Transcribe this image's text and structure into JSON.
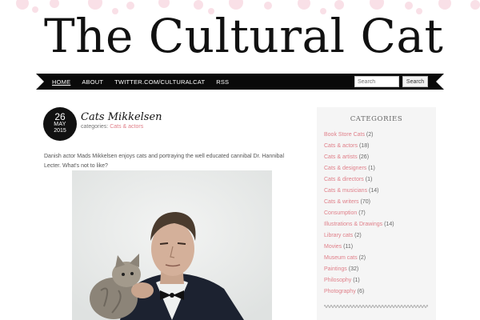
{
  "site": {
    "title": "The Cultural Cat"
  },
  "nav": {
    "items": [
      "HOME",
      "ABOUT",
      "TWITTER.COM/CULTURALCAT",
      "RSS"
    ],
    "search_placeholder": "Search",
    "search_button": "Search"
  },
  "post": {
    "date": {
      "day": "26",
      "month": "MAY",
      "year": "2015"
    },
    "title": "Cats Mikkelsen",
    "categories_label": "categories:",
    "category": "Cats & actors",
    "body": "Danish actor Mads Mikkelsen enjoys cats and portraying the well educated cannibal Dr. Hannibal Lecter. What's not to like?"
  },
  "sidebar": {
    "title": "CATEGORIES",
    "categories": [
      {
        "name": "Book Store Cats",
        "count": "(2)"
      },
      {
        "name": "Cats & actors",
        "count": "(18)"
      },
      {
        "name": "Cats & artists",
        "count": "(26)"
      },
      {
        "name": "Cats & designers",
        "count": "(1)"
      },
      {
        "name": "Cats & directors",
        "count": "(1)"
      },
      {
        "name": "Cats & musicians",
        "count": "(14)"
      },
      {
        "name": "Cats & writers",
        "count": "(70)"
      },
      {
        "name": "Consumption",
        "count": "(7)"
      },
      {
        "name": "Illustrations & Drawings",
        "count": "(14)"
      },
      {
        "name": "Library cats",
        "count": "(2)"
      },
      {
        "name": "Movies",
        "count": "(11)"
      },
      {
        "name": "Museum cats",
        "count": "(2)"
      },
      {
        "name": "Paintings",
        "count": "(32)"
      },
      {
        "name": "Philosophy",
        "count": "(1)"
      },
      {
        "name": "Photography",
        "count": "(6)"
      }
    ]
  },
  "colors": {
    "accent_pink": "#e0808a",
    "nav_black": "#0a0a0a",
    "dot_pink": "#f4c6d3",
    "sidebar_bg": "#f5f5f5"
  }
}
